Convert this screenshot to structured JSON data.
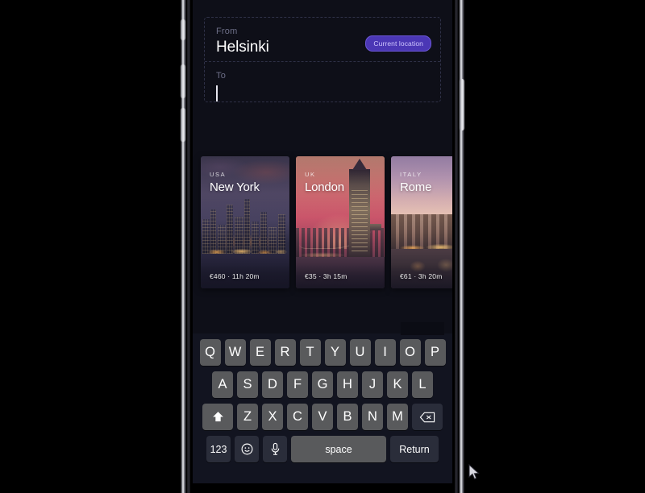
{
  "app": {
    "theme_background": "#0e0f18",
    "accent": "#4b37b5"
  },
  "search": {
    "from": {
      "label": "From",
      "value": "Helsinki"
    },
    "to": {
      "label": "To",
      "value": "",
      "caret_visible": true
    },
    "current_location_button": "Current location"
  },
  "destinations": {
    "cards": [
      {
        "country": "USA",
        "city": "New York",
        "price": "€460",
        "separator": "·",
        "duration": "11h 20m",
        "meta": "€460  ·  11h 20m"
      },
      {
        "country": "UK",
        "city": "London",
        "price": "€35",
        "separator": "·",
        "duration": "3h 15m",
        "meta": "€35  ·  3h 15m"
      },
      {
        "country": "ITALY",
        "city": "Rome",
        "price": "€61",
        "separator": "·",
        "duration": "3h 20m",
        "meta": "€61  ·  3h 20m"
      }
    ]
  },
  "keyboard": {
    "row1": [
      "Q",
      "W",
      "E",
      "R",
      "T",
      "Y",
      "U",
      "I",
      "O",
      "P"
    ],
    "row2": [
      "A",
      "S",
      "D",
      "F",
      "G",
      "H",
      "J",
      "K",
      "L"
    ],
    "row3": [
      "Z",
      "X",
      "C",
      "V",
      "B",
      "N",
      "M"
    ],
    "shift_icon": "shift-icon",
    "backspace_icon": "backspace-icon",
    "numbers_key": "123",
    "emoji_icon": "emoji-icon",
    "microphone_icon": "microphone-icon",
    "space_key": "space",
    "return_key": "Return"
  },
  "device": {
    "buttons": [
      "silent-switch",
      "volume-up",
      "volume-down",
      "power"
    ]
  }
}
